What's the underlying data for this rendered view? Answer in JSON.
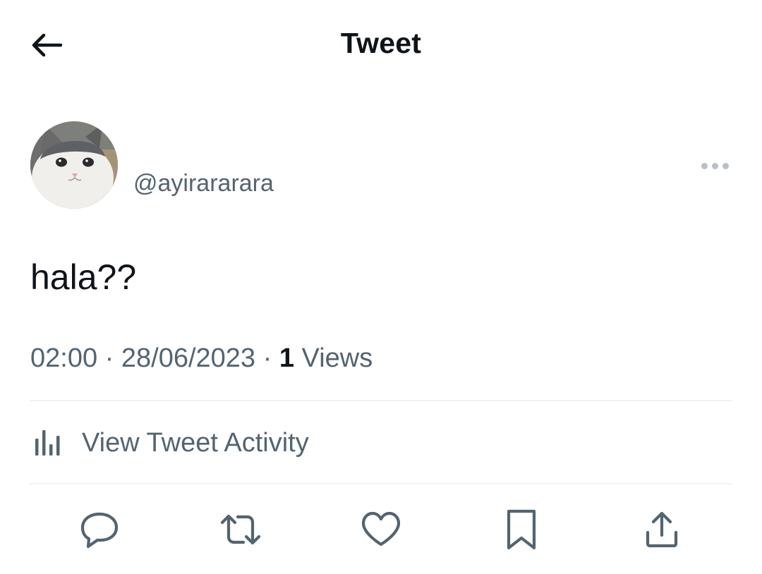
{
  "header": {
    "title": "Tweet",
    "back_icon": "arrow-left-icon"
  },
  "tweet": {
    "handle": "@ayirararara",
    "avatar_icon": "cat-avatar",
    "more_icon": "more-horizontal-icon",
    "text": "hala??",
    "time": "02:00",
    "separator": "·",
    "date": "28/06/2023",
    "views_count": "1",
    "views_label": "Views"
  },
  "activity": {
    "label": "View Tweet Activity",
    "icon": "bar-chart-icon"
  },
  "actions": [
    {
      "name": "reply",
      "icon": "reply-icon"
    },
    {
      "name": "retweet",
      "icon": "retweet-icon"
    },
    {
      "name": "like",
      "icon": "heart-icon"
    },
    {
      "name": "bookmark",
      "icon": "bookmark-icon"
    },
    {
      "name": "share",
      "icon": "share-icon"
    }
  ],
  "colors": {
    "text_primary": "#0f1419",
    "text_secondary": "#536471",
    "divider": "#eff3f4",
    "background": "#ffffff"
  }
}
